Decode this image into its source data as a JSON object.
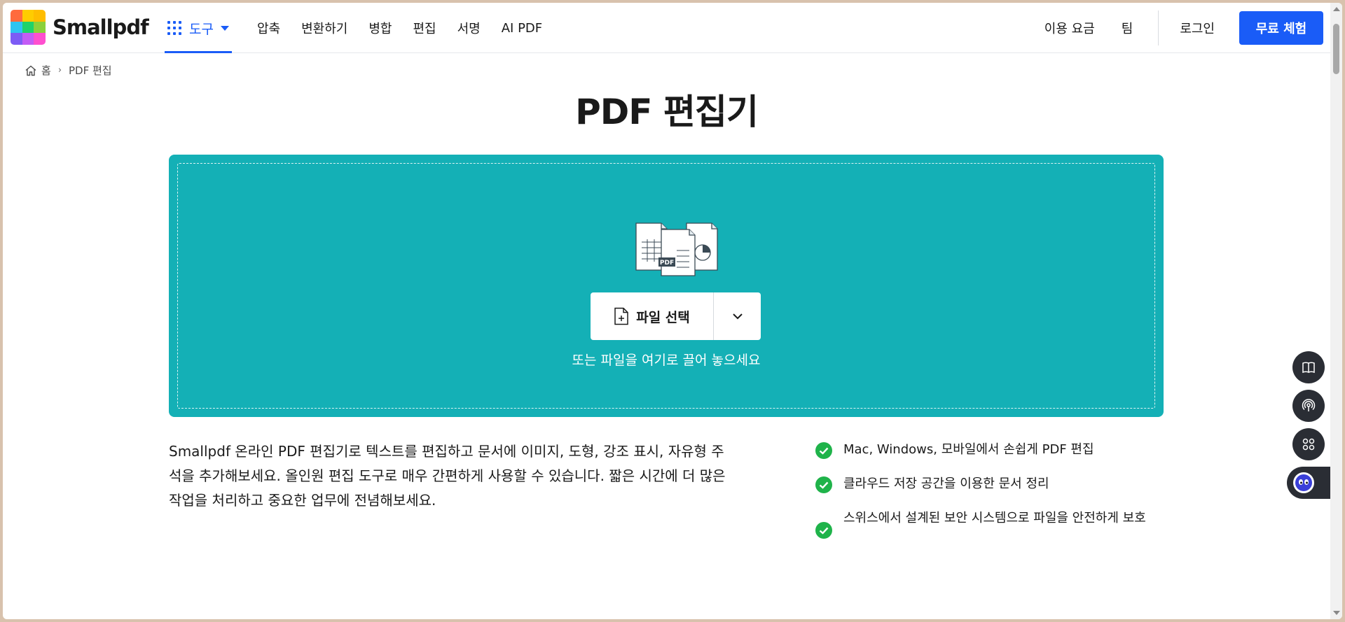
{
  "brand": {
    "name": "Smallpdf",
    "logo_colors": [
      "#ff6a3d",
      "#ffcc00",
      "#ffbd00",
      "#2ec4f1",
      "#1fd26a",
      "#8bd13b",
      "#7d5cf5",
      "#c35cf5",
      "#ff4fcf"
    ]
  },
  "nav": {
    "tools_label": "도구",
    "items": [
      "압축",
      "변환하기",
      "병합",
      "편집",
      "서명",
      "AI PDF"
    ]
  },
  "right_nav": {
    "pricing": "이용 요금",
    "team": "팀",
    "login": "로그인",
    "cta": "무료 체험"
  },
  "breadcrumb": {
    "home": "홈",
    "separator": "›",
    "current": "PDF 편집"
  },
  "page_title": "PDF 편집기",
  "dropzone": {
    "select_label": "파일 선택",
    "hint": "또는 파일을 여기로 끌어 놓으세요",
    "illustration_badge": "PDF",
    "color": "#14b0b6"
  },
  "description": "Smallpdf 온라인 PDF 편집기로 텍스트를 편집하고 문서에 이미지, 도형, 강조 표시, 자유형 주석을 추가해보세요. 올인원 편집 도구로 매우 간편하게 사용할 수 있습니다. 짧은 시간에 더 많은 작업을 처리하고 중요한 업무에 전념해보세요.",
  "features": [
    "Mac, Windows, 모바일에서 손쉽게 PDF 편집",
    "클라우드 저장 공간을 이용한 문서 정리",
    "스위스에서 설계된 보안 시스템으로 파일을 안전하게 보호"
  ],
  "accent_color": "#1a5cf7",
  "check_color": "#1fb34a"
}
